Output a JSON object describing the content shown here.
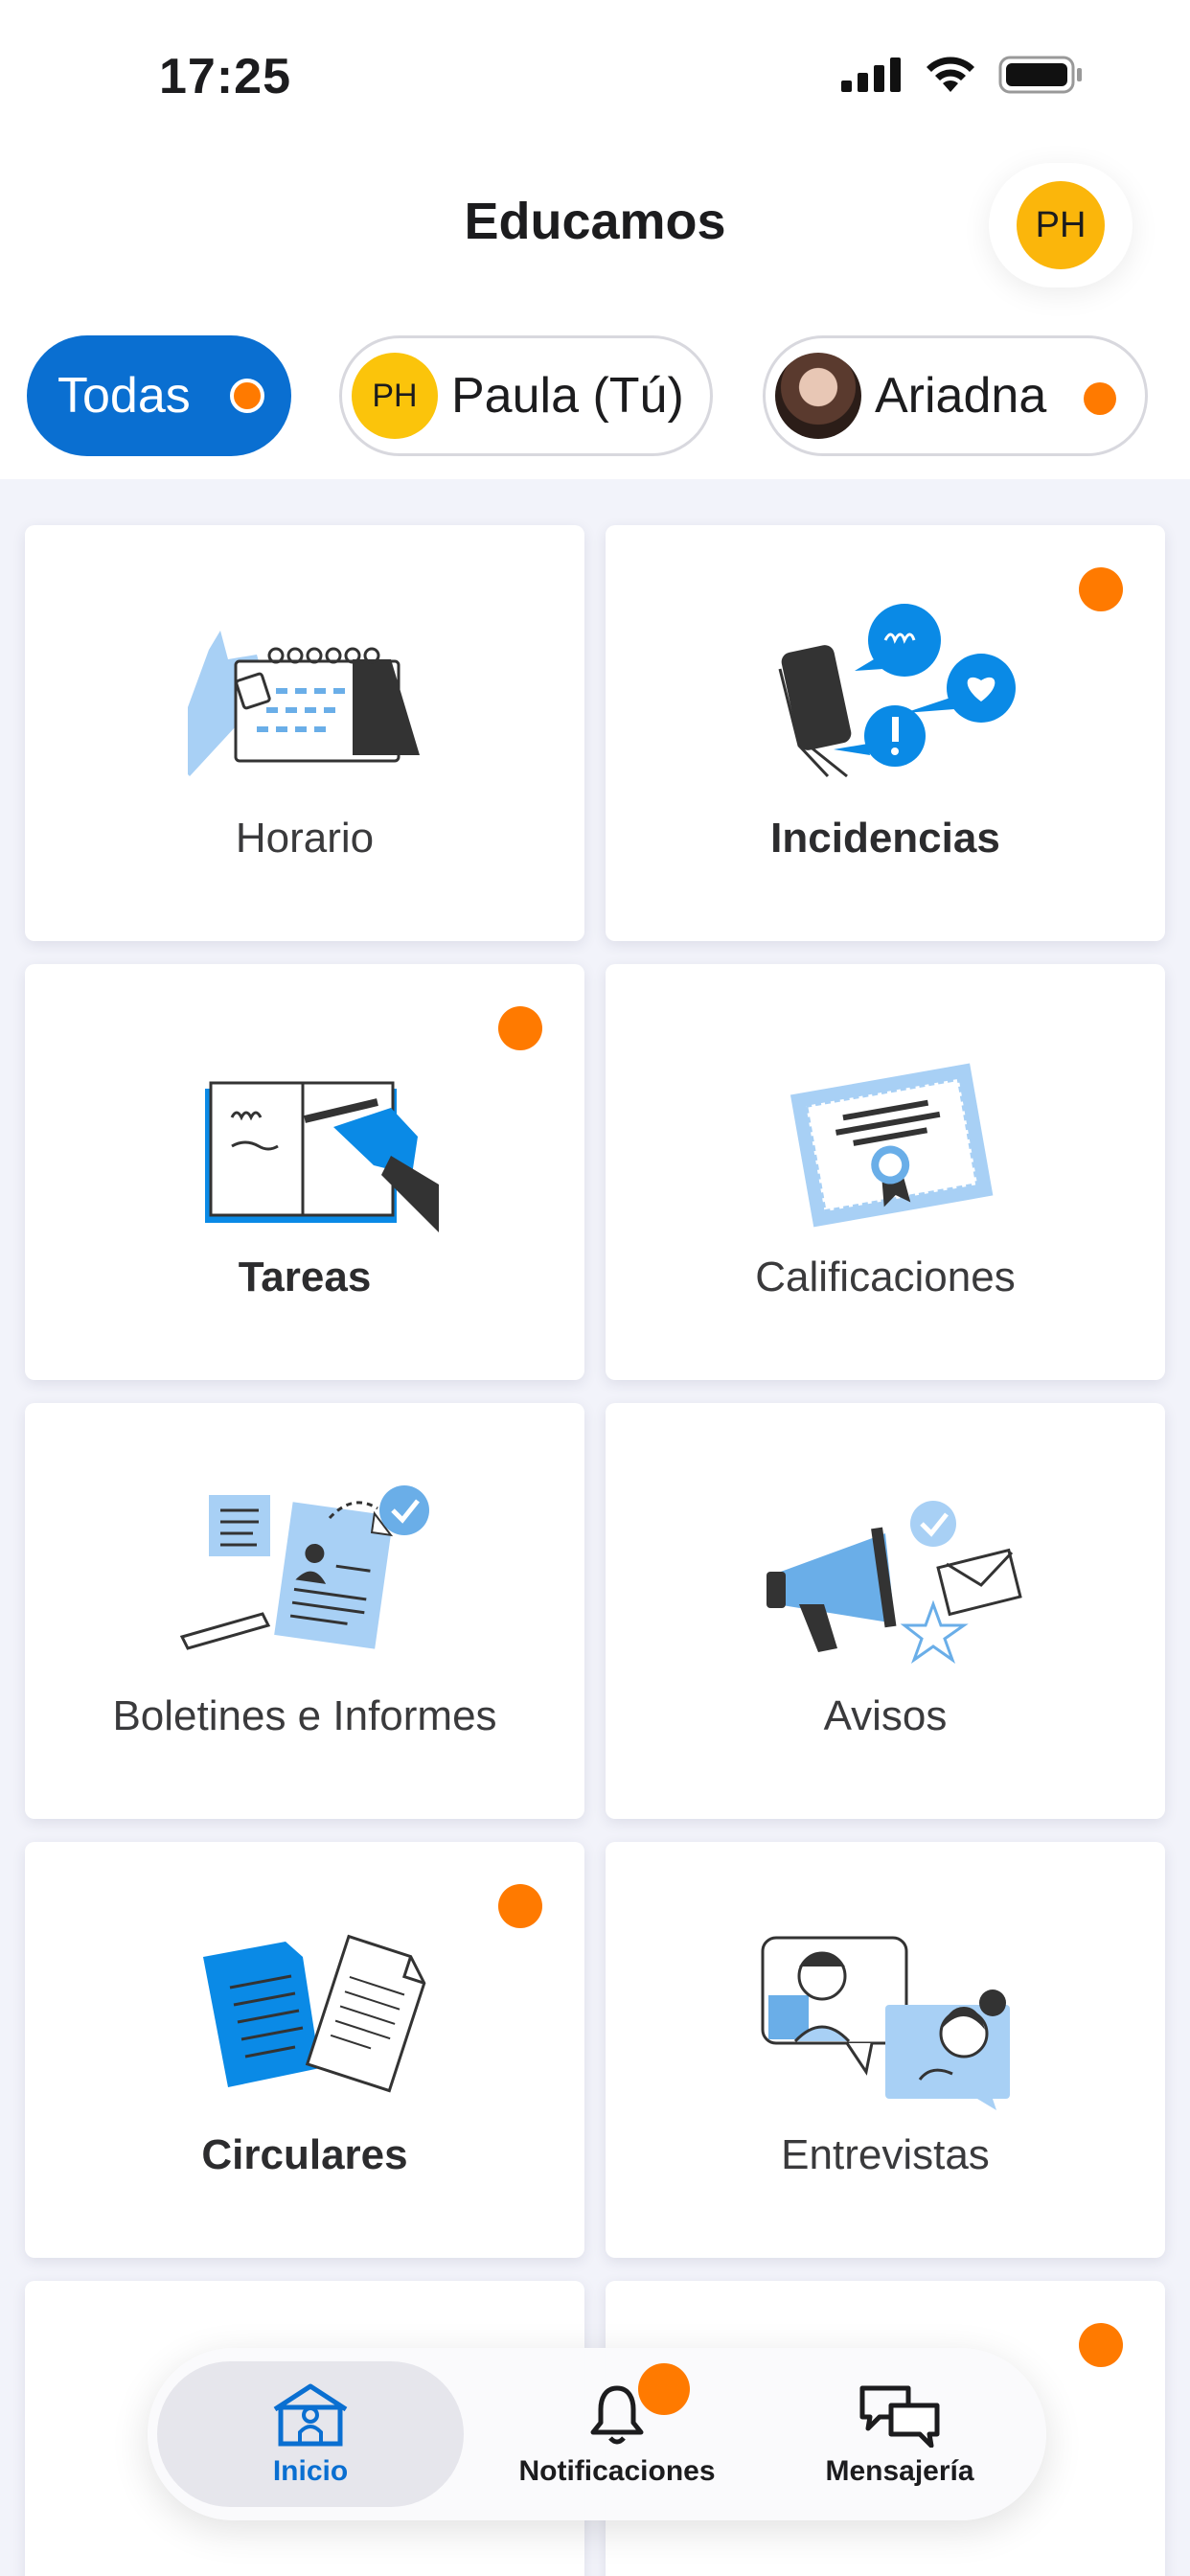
{
  "status_bar": {
    "time": "17:25"
  },
  "header": {
    "title": "Educamos",
    "avatar_initials": "PH"
  },
  "filters": {
    "all": {
      "label": "Todas"
    },
    "paula": {
      "initials": "PH",
      "label": "Paula (Tú)"
    },
    "ariadna": {
      "label": "Ariadna"
    }
  },
  "cards": [
    {
      "label": "Horario",
      "has_badge": false
    },
    {
      "label": "Incidencias",
      "has_badge": true
    },
    {
      "label": "Tareas",
      "has_badge": true
    },
    {
      "label": "Calificaciones",
      "has_badge": false
    },
    {
      "label": "Boletines e Informes",
      "has_badge": false
    },
    {
      "label": "Avisos",
      "has_badge": false
    },
    {
      "label": "Circulares",
      "has_badge": true
    },
    {
      "label": "Entrevistas",
      "has_badge": false
    }
  ],
  "tabbar": {
    "home": "Inicio",
    "notifications": "Notificaciones",
    "messages": "Mensajería"
  },
  "colors": {
    "accent": "#0a6fd1",
    "badge": "#ff7a00",
    "avatar": "#fbb60b",
    "illustration_light": "#a8d0f5",
    "illustration_dark": "#333333"
  }
}
